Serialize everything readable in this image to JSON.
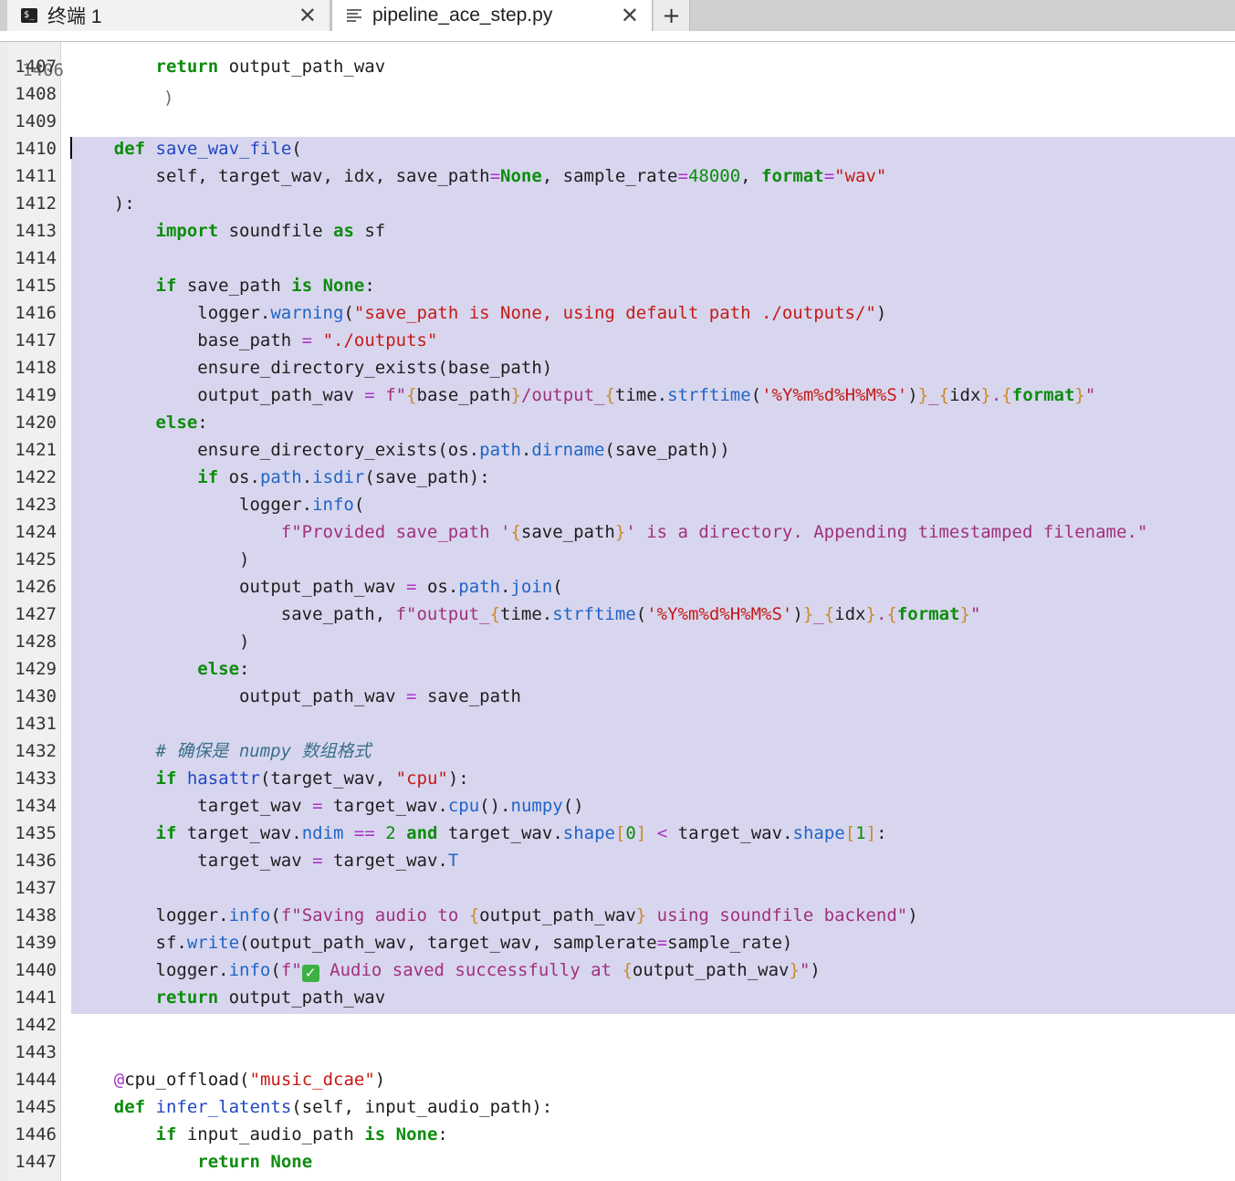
{
  "tabs": [
    {
      "label": "终端 1",
      "icon": "terminal-icon",
      "close": "✕"
    },
    {
      "label": "pipeline_ace_step.py",
      "icon": "document-lines-icon",
      "close": "✕"
    }
  ],
  "new_tab": "+",
  "colors": {
    "selection": "#d8d6ee",
    "keyword": "#0c8c0c",
    "string": "#c41a16",
    "function": "#1f48c2",
    "fstring": "#a0307e"
  },
  "editor": {
    "partial_line_number": "1406",
    "partial_line_text": ")",
    "lines": [
      {
        "n": "1407",
        "t": [
          [
            "",
            "        "
          ],
          [
            "kw",
            "return"
          ],
          [
            "",
            " output_path_wav"
          ]
        ]
      },
      {
        "n": "1408",
        "t": []
      },
      {
        "n": "1409",
        "t": []
      },
      {
        "n": "1410",
        "t": [
          [
            "",
            "    "
          ],
          [
            "kw",
            "def"
          ],
          [
            "",
            " "
          ],
          [
            "fn",
            "save_wav_file"
          ],
          [
            "",
            "("
          ]
        ]
      },
      {
        "n": "1411",
        "t": [
          [
            "",
            "        self, target_wav, idx, save_path"
          ],
          [
            "op",
            "="
          ],
          [
            "kw",
            "None"
          ],
          [
            "",
            ", sample_rate"
          ],
          [
            "op",
            "="
          ],
          [
            "num",
            "48000"
          ],
          [
            "",
            ", "
          ],
          [
            "kw",
            "format"
          ],
          [
            "op",
            "="
          ],
          [
            "str",
            "\"wav\""
          ]
        ]
      },
      {
        "n": "1412",
        "t": [
          [
            "",
            "    ):"
          ]
        ]
      },
      {
        "n": "1413",
        "t": [
          [
            "",
            "        "
          ],
          [
            "kw",
            "import"
          ],
          [
            "",
            " soundfile "
          ],
          [
            "kw",
            "as"
          ],
          [
            "",
            " sf"
          ]
        ]
      },
      {
        "n": "1414",
        "t": []
      },
      {
        "n": "1415",
        "t": [
          [
            "",
            "        "
          ],
          [
            "kw",
            "if"
          ],
          [
            "",
            " save_path "
          ],
          [
            "kw",
            "is"
          ],
          [
            "",
            " "
          ],
          [
            "kw",
            "None"
          ],
          [
            "",
            ":"
          ]
        ]
      },
      {
        "n": "1416",
        "t": [
          [
            "",
            "            logger."
          ],
          [
            "at",
            "warning"
          ],
          [
            "",
            "("
          ],
          [
            "str",
            "\"save_path is None, using default path ./outputs/\""
          ],
          [
            "",
            ")"
          ]
        ]
      },
      {
        "n": "1417",
        "t": [
          [
            "",
            "            base_path "
          ],
          [
            "op",
            "="
          ],
          [
            "",
            " "
          ],
          [
            "str",
            "\"./outputs\""
          ]
        ]
      },
      {
        "n": "1418",
        "t": [
          [
            "",
            "            ensure_directory_exists(base_path)"
          ]
        ]
      },
      {
        "n": "1419",
        "t": [
          [
            "",
            "            output_path_wav "
          ],
          [
            "op",
            "="
          ],
          [
            "",
            " "
          ],
          [
            "fs",
            "f\""
          ],
          [
            "br",
            "{"
          ],
          [
            "",
            "base_path"
          ],
          [
            "br",
            "}"
          ],
          [
            "fs",
            "/output_"
          ],
          [
            "br",
            "{"
          ],
          [
            "",
            "time."
          ],
          [
            "at",
            "strftime"
          ],
          [
            "",
            "("
          ],
          [
            "str",
            "'%Y%m%d%H%M%S'"
          ],
          [
            "",
            ")"
          ],
          [
            "br",
            "}"
          ],
          [
            "fs",
            "_"
          ],
          [
            "br",
            "{"
          ],
          [
            "",
            "idx"
          ],
          [
            "br",
            "}"
          ],
          [
            "fs",
            "."
          ],
          [
            "br",
            "{"
          ],
          [
            "kw",
            "format"
          ],
          [
            "br",
            "}"
          ],
          [
            "fs",
            "\""
          ]
        ]
      },
      {
        "n": "1420",
        "t": [
          [
            "",
            "        "
          ],
          [
            "kw",
            "else"
          ],
          [
            "",
            ":"
          ]
        ]
      },
      {
        "n": "1421",
        "t": [
          [
            "",
            "            ensure_directory_exists(os."
          ],
          [
            "at",
            "path"
          ],
          [
            "",
            "."
          ],
          [
            "at",
            "dirname"
          ],
          [
            "",
            "(save_path))"
          ]
        ]
      },
      {
        "n": "1422",
        "t": [
          [
            "",
            "            "
          ],
          [
            "kw",
            "if"
          ],
          [
            "",
            " os."
          ],
          [
            "at",
            "path"
          ],
          [
            "",
            "."
          ],
          [
            "at",
            "isdir"
          ],
          [
            "",
            "(save_path):"
          ]
        ]
      },
      {
        "n": "1423",
        "t": [
          [
            "",
            "                logger."
          ],
          [
            "at",
            "info"
          ],
          [
            "",
            "("
          ]
        ]
      },
      {
        "n": "1424",
        "t": [
          [
            "",
            "                    "
          ],
          [
            "fs",
            "f\"Provided save_path '"
          ],
          [
            "br",
            "{"
          ],
          [
            "",
            "save_path"
          ],
          [
            "br",
            "}"
          ],
          [
            "fs",
            "' is a directory. Appending timestamped filename.\""
          ]
        ]
      },
      {
        "n": "1425",
        "t": [
          [
            "",
            "                )"
          ]
        ]
      },
      {
        "n": "1426",
        "t": [
          [
            "",
            "                output_path_wav "
          ],
          [
            "op",
            "="
          ],
          [
            "",
            " os."
          ],
          [
            "at",
            "path"
          ],
          [
            "",
            "."
          ],
          [
            "at",
            "join"
          ],
          [
            "",
            "("
          ]
        ]
      },
      {
        "n": "1427",
        "t": [
          [
            "",
            "                    save_path, "
          ],
          [
            "fs",
            "f\"output_"
          ],
          [
            "br",
            "{"
          ],
          [
            "",
            "time."
          ],
          [
            "at",
            "strftime"
          ],
          [
            "",
            "("
          ],
          [
            "str",
            "'%Y%m%d%H%M%S'"
          ],
          [
            "",
            ")"
          ],
          [
            "br",
            "}"
          ],
          [
            "fs",
            "_"
          ],
          [
            "br",
            "{"
          ],
          [
            "",
            "idx"
          ],
          [
            "br",
            "}"
          ],
          [
            "fs",
            "."
          ],
          [
            "br",
            "{"
          ],
          [
            "kw",
            "format"
          ],
          [
            "br",
            "}"
          ],
          [
            "fs",
            "\""
          ]
        ]
      },
      {
        "n": "1428",
        "t": [
          [
            "",
            "                )"
          ]
        ]
      },
      {
        "n": "1429",
        "t": [
          [
            "",
            "            "
          ],
          [
            "kw",
            "else"
          ],
          [
            "",
            ":"
          ]
        ]
      },
      {
        "n": "1430",
        "t": [
          [
            "",
            "                output_path_wav "
          ],
          [
            "op",
            "="
          ],
          [
            "",
            " save_path"
          ]
        ]
      },
      {
        "n": "1431",
        "t": []
      },
      {
        "n": "1432",
        "t": [
          [
            "",
            "        "
          ],
          [
            "cmt",
            "# 确保是 numpy 数组格式"
          ]
        ]
      },
      {
        "n": "1433",
        "t": [
          [
            "",
            "        "
          ],
          [
            "kw",
            "if"
          ],
          [
            "",
            " "
          ],
          [
            "bi",
            "hasattr"
          ],
          [
            "",
            "(target_wav, "
          ],
          [
            "str",
            "\"cpu\""
          ],
          [
            "",
            "):"
          ]
        ]
      },
      {
        "n": "1434",
        "t": [
          [
            "",
            "            target_wav "
          ],
          [
            "op",
            "="
          ],
          [
            "",
            " target_wav."
          ],
          [
            "at",
            "cpu"
          ],
          [
            "",
            "()."
          ],
          [
            "at",
            "numpy"
          ],
          [
            "",
            "()"
          ]
        ]
      },
      {
        "n": "1435",
        "t": [
          [
            "",
            "        "
          ],
          [
            "kw",
            "if"
          ],
          [
            "",
            " target_wav."
          ],
          [
            "at",
            "ndim"
          ],
          [
            "",
            " "
          ],
          [
            "op",
            "=="
          ],
          [
            "",
            " "
          ],
          [
            "num",
            "2"
          ],
          [
            "",
            " "
          ],
          [
            "kw",
            "and"
          ],
          [
            "",
            " target_wav."
          ],
          [
            "at",
            "shape"
          ],
          [
            "br",
            "["
          ],
          [
            "num",
            "0"
          ],
          [
            "br",
            "]"
          ],
          [
            "",
            " "
          ],
          [
            "op",
            "<"
          ],
          [
            "",
            " target_wav."
          ],
          [
            "at",
            "shape"
          ],
          [
            "br",
            "["
          ],
          [
            "num",
            "1"
          ],
          [
            "br",
            "]"
          ],
          [
            "",
            ":"
          ]
        ]
      },
      {
        "n": "1436",
        "t": [
          [
            "",
            "            target_wav "
          ],
          [
            "op",
            "="
          ],
          [
            "",
            " target_wav."
          ],
          [
            "at",
            "T"
          ]
        ]
      },
      {
        "n": "1437",
        "t": []
      },
      {
        "n": "1438",
        "t": [
          [
            "",
            "        logger."
          ],
          [
            "at",
            "info"
          ],
          [
            "",
            "("
          ],
          [
            "fs",
            "f\"Saving audio to "
          ],
          [
            "br",
            "{"
          ],
          [
            "",
            "output_path_wav"
          ],
          [
            "br",
            "}"
          ],
          [
            "fs",
            " using soundfile backend\""
          ],
          [
            "",
            ")"
          ]
        ]
      },
      {
        "n": "1439",
        "t": [
          [
            "",
            "        sf."
          ],
          [
            "at",
            "write"
          ],
          [
            "",
            "(output_path_wav, target_wav, samplerate"
          ],
          [
            "op",
            "="
          ],
          [
            "",
            "sample_rate)"
          ]
        ]
      },
      {
        "n": "1440",
        "t": [
          [
            "",
            "        logger."
          ],
          [
            "at",
            "info"
          ],
          [
            "",
            "("
          ],
          [
            "fs",
            "f\""
          ],
          [
            "emoji",
            "✓"
          ],
          [
            "fs",
            " Audio saved successfully at "
          ],
          [
            "br",
            "{"
          ],
          [
            "",
            "output_path_wav"
          ],
          [
            "br",
            "}"
          ],
          [
            "fs",
            "\""
          ],
          [
            "",
            ")"
          ]
        ]
      },
      {
        "n": "1441",
        "t": [
          [
            "",
            "        "
          ],
          [
            "kw",
            "return"
          ],
          [
            "",
            " output_path_wav"
          ]
        ]
      },
      {
        "n": "1442",
        "t": []
      },
      {
        "n": "1443",
        "t": []
      },
      {
        "n": "1444",
        "t": [
          [
            "",
            "    "
          ],
          [
            "dec",
            "@"
          ],
          [
            "",
            "cpu_offload("
          ],
          [
            "str",
            "\"music_dcae\""
          ],
          [
            "",
            ")"
          ]
        ]
      },
      {
        "n": "1445",
        "t": [
          [
            "",
            "    "
          ],
          [
            "kw",
            "def"
          ],
          [
            "",
            " "
          ],
          [
            "fn",
            "infer_latents"
          ],
          [
            "",
            "(self, input_audio_path):"
          ]
        ]
      },
      {
        "n": "1446",
        "t": [
          [
            "",
            "        "
          ],
          [
            "kw",
            "if"
          ],
          [
            "",
            " input_audio_path "
          ],
          [
            "kw",
            "is"
          ],
          [
            "",
            " "
          ],
          [
            "kw",
            "None"
          ],
          [
            "",
            ":"
          ]
        ]
      },
      {
        "n": "1447",
        "t": [
          [
            "",
            "            "
          ],
          [
            "kw",
            "return"
          ],
          [
            "",
            " "
          ],
          [
            "kw",
            "None"
          ]
        ]
      }
    ]
  }
}
